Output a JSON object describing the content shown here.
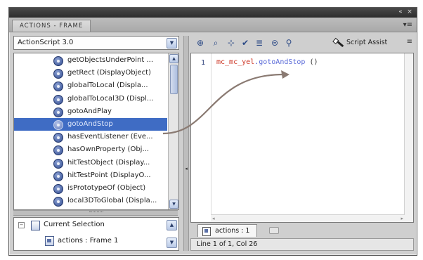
{
  "panel": {
    "title": "ACTIONS - FRAME",
    "menu_icon": "panel-menu-icon"
  },
  "language_select": {
    "value": "ActionScript 3.0"
  },
  "actions_list": {
    "items": [
      {
        "label": "getObjectsUnderPoint ..."
      },
      {
        "label": "getRect (DisplayObject)"
      },
      {
        "label": "globalToLocal (Displa..."
      },
      {
        "label": "globalToLocal3D (Displ..."
      },
      {
        "label": "gotoAndPlay"
      },
      {
        "label": "gotoAndStop",
        "selected": true
      },
      {
        "label": "hasEventListener (Eve..."
      },
      {
        "label": "hasOwnProperty (Obj..."
      },
      {
        "label": "hitTestObject (Display..."
      },
      {
        "label": "hitTestPoint (DisplayO..."
      },
      {
        "label": "isPrototypeOf (Object)"
      },
      {
        "label": "local3DToGlobal (Displa..."
      }
    ]
  },
  "selection_tree": {
    "current_selection": "Current Selection",
    "frame": "actions : Frame 1"
  },
  "toolbar": {
    "script_assist": "Script Assist",
    "icons": [
      "add-statement-icon",
      "find-icon",
      "target-path-icon",
      "check-syntax-icon",
      "auto-format-icon",
      "code-hint-icon",
      "debug-options-icon"
    ]
  },
  "editor": {
    "line_number": "1",
    "code_object": "mc_mc_yel",
    "code_dot": ".",
    "code_method": "gotoAndStop",
    "code_parens": " ()"
  },
  "doc_tab": {
    "label": "actions : 1"
  },
  "status": {
    "text": "Line 1 of 1, Col 26"
  },
  "colors": {
    "selection": "#3f6cc4",
    "code_object": "#cc3322",
    "code_method": "#5a6ad8",
    "arrow": "#8a7a72"
  }
}
